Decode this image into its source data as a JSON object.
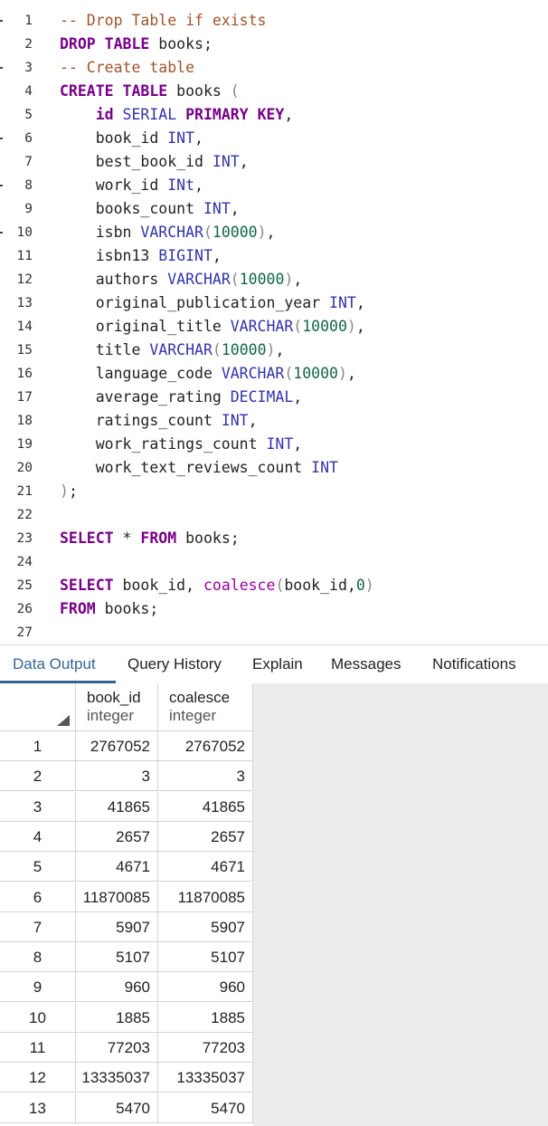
{
  "editor": {
    "lines": [
      {
        "n": "1",
        "tokens": [
          {
            "t": "-- Drop Table if exists",
            "c": "cm"
          }
        ]
      },
      {
        "n": "2",
        "tokens": [
          {
            "t": "DROP TABLE",
            "c": "kw"
          },
          {
            "t": " books;",
            "c": "plain"
          }
        ]
      },
      {
        "n": "3",
        "tokens": [
          {
            "t": "-- Create table",
            "c": "cm"
          }
        ]
      },
      {
        "n": "4",
        "tokens": [
          {
            "t": "CREATE TABLE",
            "c": "kw"
          },
          {
            "t": " books ",
            "c": "plain"
          },
          {
            "t": "(",
            "c": "punct"
          }
        ]
      },
      {
        "n": "5",
        "tokens": [
          {
            "t": "    id ",
            "c": "kw"
          },
          {
            "t": "SERIAL ",
            "c": "kw-blue"
          },
          {
            "t": "PRIMARY KEY",
            "c": "kw"
          },
          {
            "t": ",",
            "c": "plain"
          }
        ]
      },
      {
        "n": "6",
        "tokens": [
          {
            "t": "    book_id ",
            "c": "plain"
          },
          {
            "t": "INT",
            "c": "kw-blue"
          },
          {
            "t": ",",
            "c": "plain"
          }
        ]
      },
      {
        "n": "7",
        "tokens": [
          {
            "t": "    best_book_id ",
            "c": "plain"
          },
          {
            "t": "INT",
            "c": "kw-blue"
          },
          {
            "t": ",",
            "c": "plain"
          }
        ]
      },
      {
        "n": "8",
        "tokens": [
          {
            "t": "    work_id ",
            "c": "plain"
          },
          {
            "t": "INt",
            "c": "kw-blue"
          },
          {
            "t": ",",
            "c": "plain"
          }
        ]
      },
      {
        "n": "9",
        "tokens": [
          {
            "t": "    books_count ",
            "c": "plain"
          },
          {
            "t": "INT",
            "c": "kw-blue"
          },
          {
            "t": ",",
            "c": "plain"
          }
        ]
      },
      {
        "n": "10",
        "tokens": [
          {
            "t": "    isbn ",
            "c": "plain"
          },
          {
            "t": "VARCHAR",
            "c": "kw-blue"
          },
          {
            "t": "(",
            "c": "punct"
          },
          {
            "t": "10000",
            "c": "num"
          },
          {
            "t": ")",
            "c": "punct"
          },
          {
            "t": ",",
            "c": "plain"
          }
        ]
      },
      {
        "n": "11",
        "tokens": [
          {
            "t": "    isbn13 ",
            "c": "plain"
          },
          {
            "t": "BIGINT",
            "c": "kw-blue"
          },
          {
            "t": ",",
            "c": "plain"
          }
        ]
      },
      {
        "n": "12",
        "tokens": [
          {
            "t": "    authors ",
            "c": "plain"
          },
          {
            "t": "VARCHAR",
            "c": "kw-blue"
          },
          {
            "t": "(",
            "c": "punct"
          },
          {
            "t": "10000",
            "c": "num"
          },
          {
            "t": ")",
            "c": "punct"
          },
          {
            "t": ",",
            "c": "plain"
          }
        ]
      },
      {
        "n": "13",
        "tokens": [
          {
            "t": "    original_publication_year ",
            "c": "plain"
          },
          {
            "t": "INT",
            "c": "kw-blue"
          },
          {
            "t": ",",
            "c": "plain"
          }
        ]
      },
      {
        "n": "14",
        "tokens": [
          {
            "t": "    original_title ",
            "c": "plain"
          },
          {
            "t": "VARCHAR",
            "c": "kw-blue"
          },
          {
            "t": "(",
            "c": "punct"
          },
          {
            "t": "10000",
            "c": "num"
          },
          {
            "t": ")",
            "c": "punct"
          },
          {
            "t": ",",
            "c": "plain"
          }
        ]
      },
      {
        "n": "15",
        "tokens": [
          {
            "t": "    title ",
            "c": "plain"
          },
          {
            "t": "VARCHAR",
            "c": "kw-blue"
          },
          {
            "t": "(",
            "c": "punct"
          },
          {
            "t": "10000",
            "c": "num"
          },
          {
            "t": ")",
            "c": "punct"
          },
          {
            "t": ",",
            "c": "plain"
          }
        ]
      },
      {
        "n": "16",
        "tokens": [
          {
            "t": "    language_code ",
            "c": "plain"
          },
          {
            "t": "VARCHAR",
            "c": "kw-blue"
          },
          {
            "t": "(",
            "c": "punct"
          },
          {
            "t": "10000",
            "c": "num"
          },
          {
            "t": ")",
            "c": "punct"
          },
          {
            "t": ",",
            "c": "plain"
          }
        ]
      },
      {
        "n": "17",
        "tokens": [
          {
            "t": "    average_rating ",
            "c": "plain"
          },
          {
            "t": "DECIMAL",
            "c": "kw-blue"
          },
          {
            "t": ",",
            "c": "plain"
          }
        ]
      },
      {
        "n": "18",
        "tokens": [
          {
            "t": "    ratings_count ",
            "c": "plain"
          },
          {
            "t": "INT",
            "c": "kw-blue"
          },
          {
            "t": ",",
            "c": "plain"
          }
        ]
      },
      {
        "n": "19",
        "tokens": [
          {
            "t": "    work_ratings_count ",
            "c": "plain"
          },
          {
            "t": "INT",
            "c": "kw-blue"
          },
          {
            "t": ",",
            "c": "plain"
          }
        ]
      },
      {
        "n": "20",
        "tokens": [
          {
            "t": "    work_text_reviews_count ",
            "c": "plain"
          },
          {
            "t": "INT",
            "c": "kw-blue"
          }
        ]
      },
      {
        "n": "21",
        "tokens": [
          {
            "t": ")",
            "c": "punct"
          },
          {
            "t": ";",
            "c": "plain"
          }
        ]
      },
      {
        "n": "22",
        "tokens": []
      },
      {
        "n": "23",
        "tokens": [
          {
            "t": "SELECT",
            "c": "kw"
          },
          {
            "t": " * ",
            "c": "plain"
          },
          {
            "t": "FROM",
            "c": "kw"
          },
          {
            "t": " books;",
            "c": "plain"
          }
        ]
      },
      {
        "n": "24",
        "tokens": []
      },
      {
        "n": "25",
        "tokens": [
          {
            "t": "SELECT",
            "c": "kw"
          },
          {
            "t": " book_id, ",
            "c": "plain"
          },
          {
            "t": "coalesce",
            "c": "fn"
          },
          {
            "t": "(",
            "c": "punct"
          },
          {
            "t": "book_id,",
            "c": "plain"
          },
          {
            "t": "0",
            "c": "num"
          },
          {
            "t": ")",
            "c": "punct"
          }
        ]
      },
      {
        "n": "26",
        "tokens": [
          {
            "t": "FROM",
            "c": "kw"
          },
          {
            "t": " books;",
            "c": "plain"
          }
        ]
      },
      {
        "n": "27",
        "tokens": []
      }
    ]
  },
  "tabs": [
    {
      "label": "Data Output",
      "active": true
    },
    {
      "label": "Query History",
      "active": false
    },
    {
      "label": "Explain",
      "active": false
    },
    {
      "label": "Messages",
      "active": false
    },
    {
      "label": "Notifications",
      "active": false
    }
  ],
  "grid": {
    "columns": [
      {
        "name": "book_id",
        "type": "integer"
      },
      {
        "name": "coalesce",
        "type": "integer"
      }
    ],
    "rows": [
      {
        "n": "1",
        "book_id": "2767052",
        "coalesce": "2767052"
      },
      {
        "n": "2",
        "book_id": "3",
        "coalesce": "3"
      },
      {
        "n": "3",
        "book_id": "41865",
        "coalesce": "41865"
      },
      {
        "n": "4",
        "book_id": "2657",
        "coalesce": "2657"
      },
      {
        "n": "5",
        "book_id": "4671",
        "coalesce": "4671"
      },
      {
        "n": "6",
        "book_id": "11870085",
        "coalesce": "11870085"
      },
      {
        "n": "7",
        "book_id": "5907",
        "coalesce": "5907"
      },
      {
        "n": "8",
        "book_id": "5107",
        "coalesce": "5107"
      },
      {
        "n": "9",
        "book_id": "960",
        "coalesce": "960"
      },
      {
        "n": "10",
        "book_id": "1885",
        "coalesce": "1885"
      },
      {
        "n": "11",
        "book_id": "77203",
        "coalesce": "77203"
      },
      {
        "n": "12",
        "book_id": "13335037",
        "coalesce": "13335037"
      },
      {
        "n": "13",
        "book_id": "5470",
        "coalesce": "5470"
      }
    ]
  },
  "colors": {
    "keyword": "#770088",
    "type": "#3333aa",
    "comment": "#a0522d",
    "number": "#116644",
    "tab_active": "#326690"
  }
}
